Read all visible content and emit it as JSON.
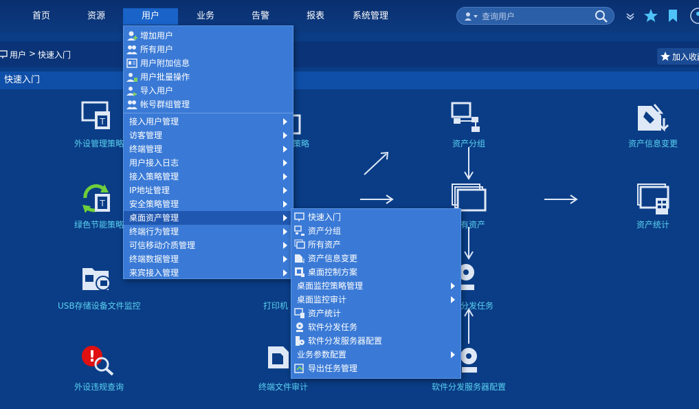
{
  "nav": {
    "items": [
      "首页",
      "资源",
      "用户",
      "业务",
      "告警",
      "报表",
      "系统管理"
    ],
    "active_index": 2
  },
  "search": {
    "placeholder": "查询用户"
  },
  "breadcrumb": {
    "section": "用户",
    "separator": ">",
    "current": "快速入门"
  },
  "favorite_button": {
    "label": "加入收藏"
  },
  "section_title": "快速入门",
  "tiles": {
    "peripheral_policy": "外设管理策略",
    "green_policy": "绿色节能策略",
    "usb_monitor": "USB存储设备文件监控",
    "peripheral_violation": "外设违规查询",
    "policy_partial": "策略",
    "printer_partial": "打印机",
    "file_audit": "终端文件审计",
    "asset_group": "资产分组",
    "all_assets_partial": "有资产",
    "dispatch_partial": "分发任务",
    "dispatch_server": "软件分发服务器配置",
    "asset_change": "资产信息变更",
    "asset_stats": "资产统计"
  },
  "user_menu": {
    "icon_items": [
      "增加用户",
      "所有用户",
      "用户附加信息",
      "用户批量操作",
      "导入用户",
      "帐号群组管理"
    ],
    "sub_items": [
      "接入用户管理",
      "访客管理",
      "终端管理",
      "用户接入日志",
      "接入策略管理",
      "IP地址管理",
      "安全策略管理",
      "桌面资产管理",
      "终端行为管理",
      "可信移动介质管理",
      "终端数据管理",
      "来宾接入管理"
    ],
    "highlighted": "桌面资产管理"
  },
  "asset_menu": {
    "items": [
      {
        "label": "快速入门",
        "icon": "monitor-icon",
        "sub": false
      },
      {
        "label": "资产分组",
        "icon": "asset-group-icon",
        "sub": false
      },
      {
        "label": "所有资产",
        "icon": "all-assets-icon",
        "sub": false
      },
      {
        "label": "资产信息变更",
        "icon": "asset-change-icon",
        "sub": false
      },
      {
        "label": "桌面控制方案",
        "icon": "desktop-control-icon",
        "sub": false
      },
      {
        "label": "桌面监控策略管理",
        "icon": "",
        "sub": true
      },
      {
        "label": "桌面监控审计",
        "icon": "",
        "sub": true
      },
      {
        "label": "资产统计",
        "icon": "asset-stats-icon",
        "sub": false
      },
      {
        "label": "软件分发任务",
        "icon": "dispatch-task-icon",
        "sub": false
      },
      {
        "label": "软件分发服务器配置",
        "icon": "dispatch-server-icon",
        "sub": false
      },
      {
        "label": "业务参数配置",
        "icon": "",
        "sub": true
      },
      {
        "label": "导出任务管理",
        "icon": "export-task-icon",
        "sub": false
      }
    ]
  },
  "colors": {
    "background": "#0a3d86",
    "menu_bg": "#3a7ad6",
    "menu_highlight": "#2057b0",
    "tile_label": "#5ad0f0"
  }
}
